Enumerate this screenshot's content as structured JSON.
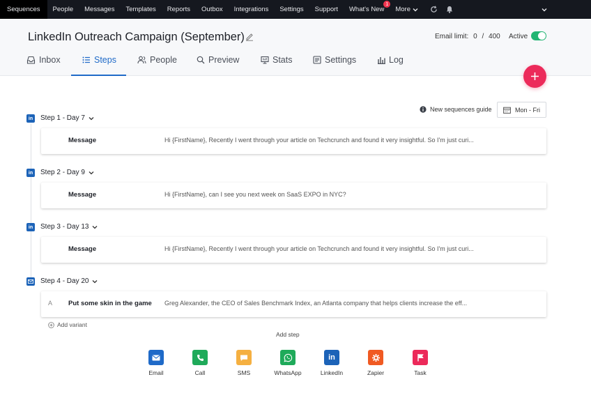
{
  "topnav": {
    "items": [
      "Sequences",
      "People",
      "Messages",
      "Templates",
      "Reports",
      "Outbox",
      "Integrations",
      "Settings",
      "Support",
      "What's New",
      "More"
    ],
    "whats_new_badge": "1"
  },
  "header": {
    "title": "LinkedIn Outreach Campaign (September)",
    "email_limit_label": "Email limit:",
    "email_limit_used": "0",
    "email_limit_sep": "/",
    "email_limit_total": "400",
    "active_label": "Active",
    "active_on": true
  },
  "tabs": [
    {
      "label": "Inbox",
      "icon": "inbox-icon"
    },
    {
      "label": "Steps",
      "icon": "list-icon"
    },
    {
      "label": "People",
      "icon": "people-icon"
    },
    {
      "label": "Preview",
      "icon": "search-icon"
    },
    {
      "label": "Stats",
      "icon": "stats-icon"
    },
    {
      "label": "Settings",
      "icon": "settings-icon"
    },
    {
      "label": "Log",
      "icon": "log-icon"
    }
  ],
  "active_tab": "Steps",
  "toolbar": {
    "guide_label": "New sequences guide",
    "schedule_label": "Mon - Fri"
  },
  "steps": [
    {
      "title": "Step 1 - Day 7",
      "channel": "linkedin",
      "card_label": "Message",
      "preview": "Hi {FirstName}, Recently I went through your article on Techcrunch and found it very insightful. So I'm just curi..."
    },
    {
      "title": "Step 2 - Day 9",
      "channel": "linkedin",
      "card_label": "Message",
      "preview": "Hi {FirstName}, can I see you next week on SaaS EXPO in NYC?"
    },
    {
      "title": "Step 3 - Day 13",
      "channel": "linkedin",
      "card_label": "Message",
      "preview": "Hi {FirstName}, Recently I went through your article on Techcrunch and found it very insightful. So I'm just curi..."
    },
    {
      "title": "Step 4 - Day 20",
      "channel": "email",
      "variant": "A",
      "card_label": "Put some skin in the game",
      "preview": "Greg Alexander, the CEO of Sales Benchmark Index, an Atlanta company that helps clients increase the eff..."
    }
  ],
  "add_variant_label": "Add variant",
  "add_step_label": "Add step",
  "channels": [
    {
      "label": "Email",
      "color": "#1f6ac8",
      "icon": "mail-icon"
    },
    {
      "label": "Call",
      "color": "#1faa5a",
      "icon": "phone-icon"
    },
    {
      "label": "SMS",
      "color": "#f5b041",
      "icon": "chat-icon"
    },
    {
      "label": "WhatsApp",
      "color": "#1faa5a",
      "icon": "whatsapp-icon"
    },
    {
      "label": "LinkedIn",
      "color": "#1c63b8",
      "icon": "linkedin-icon"
    },
    {
      "label": "Zapier",
      "color": "#f05a22",
      "icon": "zapier-icon"
    },
    {
      "label": "Task",
      "color": "#ec2a5a",
      "icon": "flag-icon"
    }
  ],
  "colors": {
    "nav_bg": "#15181f",
    "accent": "#1f6ac8",
    "fab": "#ec2a5a",
    "toggle_on": "#22b573"
  }
}
